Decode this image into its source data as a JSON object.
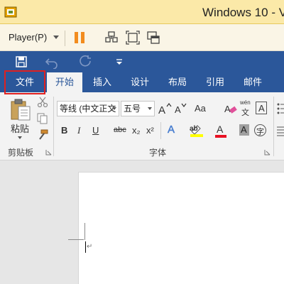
{
  "vm": {
    "title": "Windows 10 - V",
    "player_menu": "Player(P)",
    "icons": [
      "vmware-logo-icon",
      "pause-icon",
      "send-ctrl-alt-del-icon",
      "fit-window-icon",
      "unity-icon"
    ]
  },
  "word": {
    "qat_icons": [
      "save-icon",
      "undo-icon",
      "redo-icon",
      "customize-qat-icon"
    ],
    "tabs": [
      {
        "label": "文件"
      },
      {
        "label": "开始"
      },
      {
        "label": "插入"
      },
      {
        "label": "设计"
      },
      {
        "label": "布局"
      },
      {
        "label": "引用"
      },
      {
        "label": "邮件"
      }
    ],
    "clipboard": {
      "paste_label": "粘贴",
      "group_label": "剪贴板"
    },
    "font": {
      "font_name": "等线 (中文正文",
      "font_size": "五号",
      "aa_label": "Aa",
      "pinyin_top": "wén",
      "pinyin_char": "文",
      "border_char": "A",
      "bold": "B",
      "italic": "I",
      "underline": "U",
      "strike": "abc",
      "subscript": "x₂",
      "superscript": "x²",
      "text_effect": "A",
      "font_color": "A",
      "shading": "A",
      "enclose_char": "字",
      "group_label": "字体"
    },
    "colors": {
      "ribbon_blue": "#2b579a",
      "highlight_red": "#e02020",
      "highlight_yellow": "#ffff00",
      "font_red": "#e81123"
    }
  }
}
